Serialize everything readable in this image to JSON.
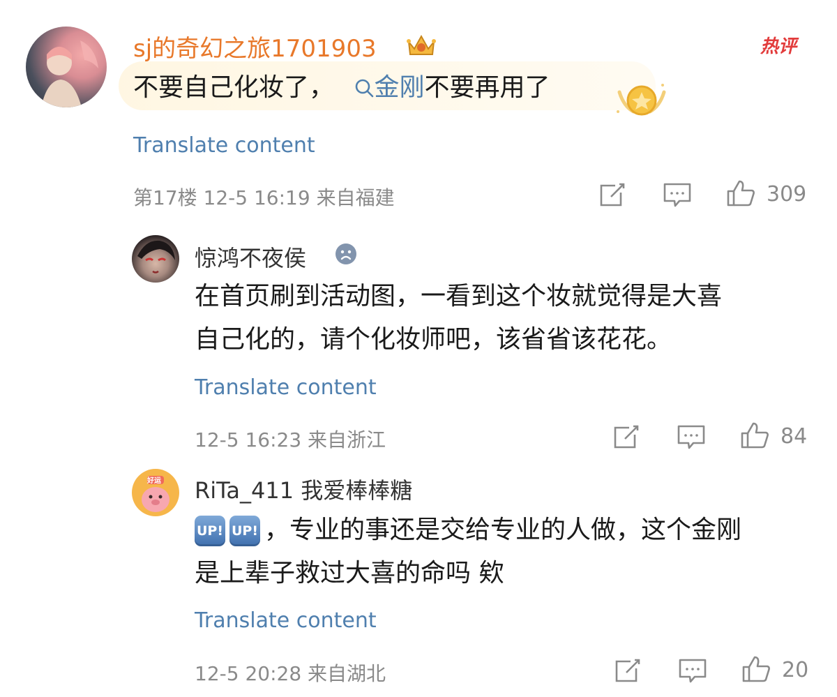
{
  "comments": [
    {
      "username": "sj的奇幻之旅1701903",
      "hot_label": "热评",
      "text_before": "不要自己化妆了，",
      "search_term": "金刚",
      "text_after": "不要再用了",
      "translate_label": "Translate content",
      "meta": "第17楼 12-5 16:19 来自福建",
      "likes": "309",
      "avatar_icon": "user-avatar-photo",
      "badge_icon": "crown-badge-icon"
    },
    {
      "username": "惊鸿不夜侯",
      "line1": "在首页刷到活动图，一看到这个妆就觉得是大喜",
      "line2": "自己化的，请个化妆师吧，该省省该花花。",
      "translate_label": "Translate content",
      "meta": "12-5 16:23 来自浙江",
      "likes": "84",
      "badge_icon": "sad-face-icon"
    },
    {
      "username": "RiTa_411 我爱棒棒糖",
      "up_badge": "UP!",
      "line1_text": "，专业的事还是交给专业的人做，这个金刚",
      "line2": "是上辈子救过大喜的命吗 欸",
      "translate_label": "Translate content",
      "meta": "12-5 20:28 来自湖北",
      "likes": "20",
      "avatar_label": "好运"
    }
  ],
  "colors": {
    "username_accent": "#e8782a",
    "link": "#4f7fae",
    "hot_label": "#e23b3b",
    "meta": "#8a8a8a"
  }
}
